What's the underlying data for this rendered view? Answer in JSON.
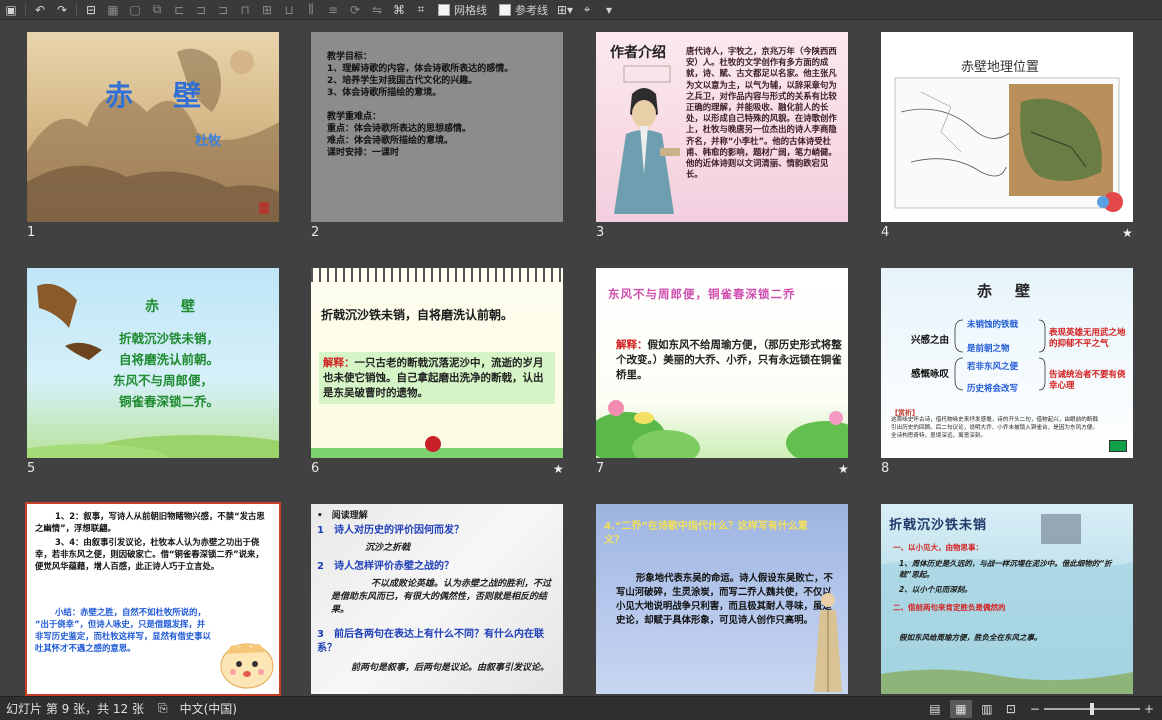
{
  "toolbar": {
    "gridlines_label": "网格线",
    "guides_label": "参考线"
  },
  "slides": [
    {
      "num": "1",
      "title": "赤　壁",
      "author": "杜牧"
    },
    {
      "num": "2",
      "lines": [
        "教学目标：",
        "1、理解诗歌的内容，体会诗歌所表达的感情。",
        "2、培养学生对我国古代文化的兴趣。",
        "3、体会诗歌所描绘的意境。",
        "",
        "教学重难点：",
        "重点：体会诗歌所表达的思想感情。",
        "难点：体会诗歌所描绘的意境。",
        "课时安排：一课时"
      ]
    },
    {
      "num": "3",
      "title": "作者介绍",
      "body": "唐代诗人，字牧之，京兆万年（今陕西西安）人。杜牧的文学创作有多方面的成就，诗、赋、古文都足以名家。他主张凡为文以意为主，以气为辅，以辞采章句为之兵卫，对作品内容与形式的关系有比较正确的理解，并能吸收、融化前人的长处，以形成自己特殊的风貌。在诗歌创作上，杜牧与晚唐另一位杰出的诗人李商隐齐名，并称“小李杜”。他的古体诗受杜甫、韩愈的影响，题材广阔，笔力峭健。他的近体诗则以文词清丽、情韵跌宕见长。"
    },
    {
      "num": "4",
      "title": "赤壁地理位置"
    },
    {
      "num": "5",
      "title": "赤　壁",
      "lines": [
        "折戟沉沙铁未销，",
        "自将磨洗认前朝。",
        "东风不与周郎便，",
        "铜雀春深锁二乔。"
      ]
    },
    {
      "num": "6",
      "heading": "折戟沉沙铁未销，自将磨洗认前朝。",
      "label": "解释：",
      "body": "一只古老的断戟沉落泥沙中，流逝的岁月也未使它销蚀。自己拿起磨出洗净的断戟，认出是东吴破曹时的遗物。"
    },
    {
      "num": "7",
      "heading": "东风不与周郎便，铜雀春深锁二乔",
      "label": "解释：",
      "body": "假如东风不给周瑜方便，（那历史形式将整个改变。）美丽的大乔、小乔，只有永远锁在铜雀桥里。"
    },
    {
      "num": "8",
      "title": "赤　壁",
      "left": [
        "兴感之由",
        "感慨咏叹"
      ],
      "mid": [
        "未销蚀的铁戟",
        "是前朝之物",
        "若非东风之便",
        "历史将会改写"
      ],
      "right": [
        "表现英雄无用武之地的抑郁不平之气",
        "告诫统治者不要有侥幸心理"
      ],
      "note_title": "【赏析】",
      "note": "这首咏史怀古诗，借托物咏史来抒发感慨，诗的开头二句，借物起兴，由眼前的断戟引出历史的回顾。后二句议论，说明大乔、小乔未被锁入铜雀台，是因为东风方便。全诗构思奇特，意境深远，寓意深刻。"
    },
    {
      "num": "9",
      "p1": "1、2：叙事，写诗人从前朝旧物睹物兴感，不禁“发古思之幽情”，浮想联翩。",
      "p2": "3、4：由叙事引发议论，杜牧本人认为赤壁之功出于侥幸，若非东风之便，则因破家亡。借“铜雀春深锁二乔”说来，便觉风华蕴藉，增人百感，此正诗人巧于立言处。",
      "p3a": "小结：赤壁之胜，自然不如杜牧所说的，",
      "p3b": "“出于侥幸”，但诗人咏史，只是借题发挥，并",
      "p3c": "非写历史鉴定，而杜牧这样写，显然有借史事以",
      "p3d": "吐其怀才不遇之感的意思。"
    },
    {
      "num": "10",
      "title": "阅读理解",
      "q1": "1　诗人对历史的评价因何而发？",
      "a1": "沉沙之折戟",
      "q2": "2　诗人怎样评价赤壁之战的？",
      "a2": "不以成败论英雄。认为赤壁之战的胜利，不过是借助东风而已，有很大的偶然性，否则就是相反的结果。",
      "q3": "3　前后各两句在表达上有什么不同？有什么内在联系？",
      "a3": "前两句是叙事，后两句是议论。由叙事引发议论。"
    },
    {
      "num": "11",
      "q": "4.“二乔”在诗歌中指代什么？这样写有什么意义？",
      "body": "形象地代表东吴的命运。诗人假设东吴败亡，不写山河破碎，生灵涂炭，而写二乔人魏共使，不仅以小见大地说明战争只利害，而且极其耐人寻味，虽是史论，却赋于具体形象，可见诗人创作只高明。"
    },
    {
      "num": "12",
      "title": "折戟沉沙铁未销",
      "sub1": "一、以小见大，由物思事：",
      "i1": "1、周体历史是久远的，与战一样沉埋在泥沙中。借此细物的“折戟”思起。",
      "i2": "2、以小个见而深刻。",
      "sub2": "二、借前两句来肯定胜负是偶然的",
      "i3": "假如东风给周瑜方便，胜负全在东风之事。"
    }
  ],
  "status": {
    "slide_info": "幻灯片 第 9 张，共 12 张",
    "language": "中文(中国)"
  }
}
